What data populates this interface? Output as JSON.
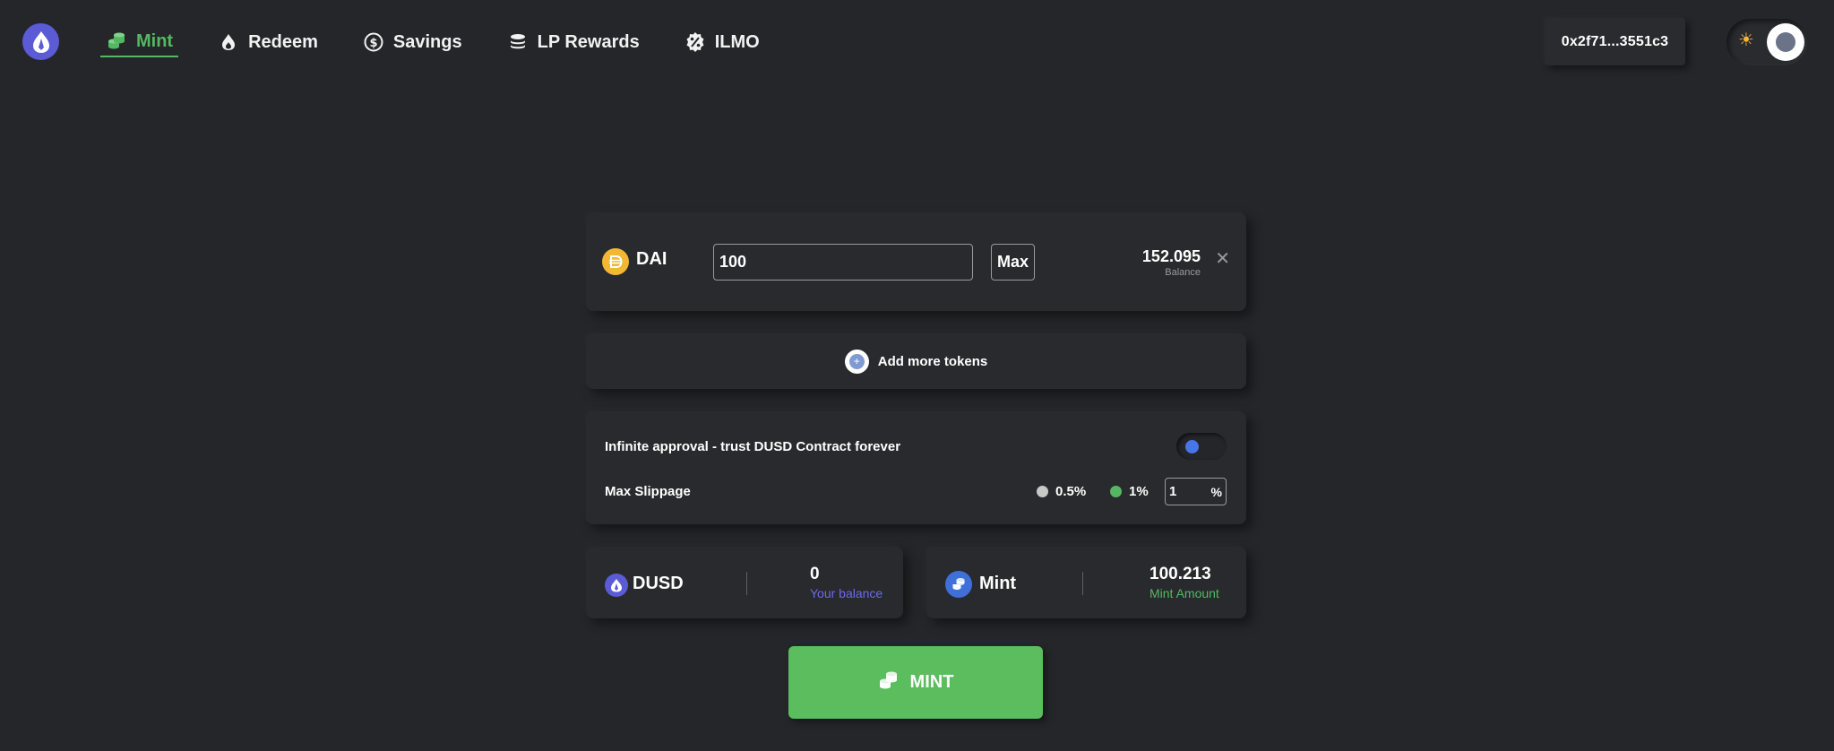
{
  "nav": {
    "items": [
      {
        "label": "Mint",
        "icon": "coins-icon",
        "active": true
      },
      {
        "label": "Redeem",
        "icon": "flame-icon",
        "active": false
      },
      {
        "label": "Savings",
        "icon": "dollar-circle-icon",
        "active": false
      },
      {
        "label": "LP Rewards",
        "icon": "stack-icon",
        "active": false
      },
      {
        "label": "ILMO",
        "icon": "percent-badge-icon",
        "active": false
      }
    ]
  },
  "header": {
    "wallet_address": "0x2f71...3551c3"
  },
  "token_input": {
    "token": "DAI",
    "amount": "100",
    "max_label": "Max",
    "balance": "152.095",
    "balance_label": "Balance"
  },
  "add_tokens": {
    "label": "Add more tokens"
  },
  "settings": {
    "approval_label": "Infinite approval - trust DUSD Contract forever",
    "slippage_label": "Max Slippage",
    "slippage_options": [
      "0.5%",
      "1%"
    ],
    "slippage_value": "1",
    "slippage_unit": "%"
  },
  "dusd_summary": {
    "token": "DUSD",
    "value": "0",
    "caption": "Your balance"
  },
  "mint_summary": {
    "label": "Mint",
    "value": "100.213",
    "caption": "Mint Amount"
  },
  "mint_button": {
    "label": "MINT"
  },
  "colors": {
    "background": "#25262a",
    "card": "#292a2e",
    "accent_green": "#54b862",
    "accent_blue": "#5b5bd6",
    "dai_yellow": "#f4b731"
  }
}
